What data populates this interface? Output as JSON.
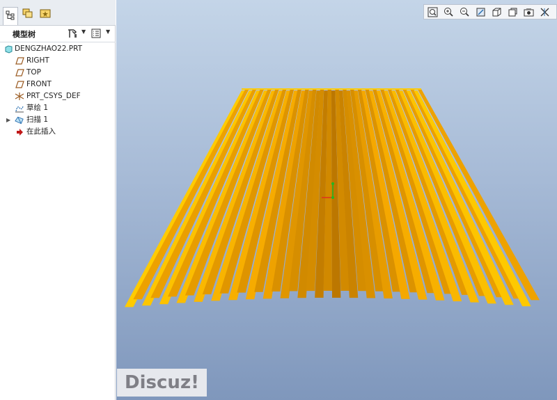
{
  "sidebar": {
    "tabs": [
      {
        "name": "model-tree-tab",
        "icon": "model-tree-icon"
      },
      {
        "name": "folder-browser-tab",
        "icon": "folder-browser-icon"
      },
      {
        "name": "favorites-tab",
        "icon": "favorites-icon"
      }
    ],
    "toolbar": {
      "title": "模型树",
      "settings_icon": "tree-settings-icon",
      "filters_icon": "tree-filters-icon"
    },
    "tree": [
      {
        "label": "DENGZHAO22.PRT",
        "icon": "part-icon",
        "indent": 0
      },
      {
        "label": "RIGHT",
        "icon": "datum-plane-icon",
        "indent": 1
      },
      {
        "label": "TOP",
        "icon": "datum-plane-icon",
        "indent": 1
      },
      {
        "label": "FRONT",
        "icon": "datum-plane-icon",
        "indent": 1
      },
      {
        "label": "PRT_CSYS_DEF",
        "icon": "coordinate-system-icon",
        "indent": 1
      },
      {
        "label": "草绘 1",
        "icon": "sketch-icon",
        "indent": 1
      },
      {
        "label": "扫描 1",
        "icon": "sweep-icon",
        "indent": 1,
        "expandable": true
      },
      {
        "label": "在此插入",
        "icon": "insert-here-arrow-icon",
        "indent": 1
      }
    ]
  },
  "viewport": {
    "toolbar": [
      "refit-icon",
      "zoom-in-icon",
      "zoom-out-icon",
      "repaint-icon",
      "display-style-icon",
      "saved-views-icon",
      "view-manager-icon",
      "datum-display-icon"
    ],
    "model_colors": {
      "light": "#ffcc00",
      "mid": "#f5a800",
      "dark": "#b87400"
    },
    "csys_colors": {
      "axis_green": "#22b722",
      "axis_red": "#e03020"
    }
  },
  "watermark": "Discuz!"
}
